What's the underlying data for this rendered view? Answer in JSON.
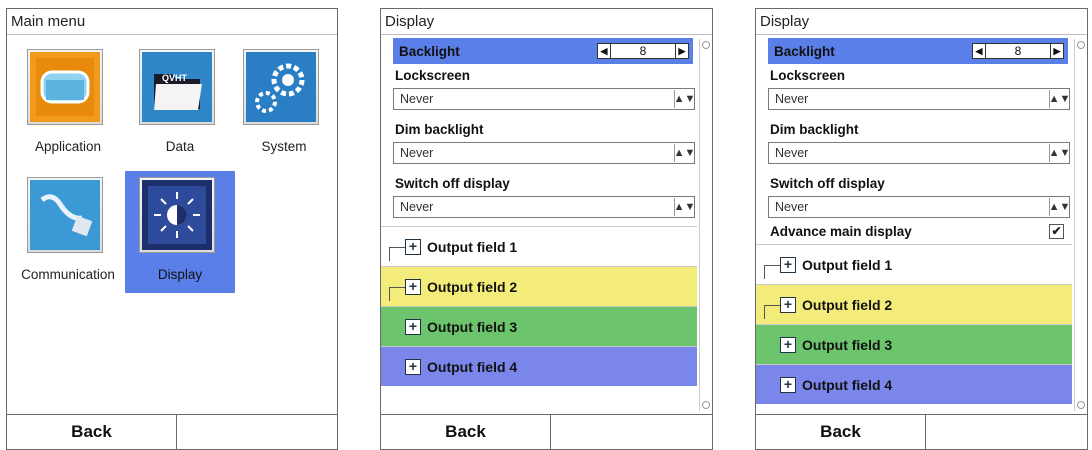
{
  "main_menu": {
    "title": "Main menu",
    "tiles": [
      {
        "label": "Application",
        "icon": "application-icon"
      },
      {
        "label": "Data",
        "icon": "data-folder-icon",
        "badge": "QVHT"
      },
      {
        "label": "System",
        "icon": "system-gears-icon"
      },
      {
        "label": "Communication",
        "icon": "communication-cable-icon"
      },
      {
        "label": "Display",
        "icon": "display-brightness-icon",
        "selected": true
      }
    ],
    "back_label": "Back"
  },
  "display_a": {
    "title": "Display",
    "backlight_label": "Backlight",
    "backlight_value": "8",
    "lockscreen_label": "Lockscreen",
    "lockscreen_value": "Never",
    "dim_label": "Dim backlight",
    "dim_value": "Never",
    "switchoff_label": "Switch off display",
    "switchoff_value": "Never",
    "output_fields": [
      "Output field 1",
      "Output field 2",
      "Output field 3",
      "Output field 4"
    ],
    "back_label": "Back"
  },
  "display_b": {
    "title": "Display",
    "backlight_label": "Backlight",
    "backlight_value": "8",
    "lockscreen_label": "Lockscreen",
    "lockscreen_value": "Never",
    "dim_label": "Dim backlight",
    "dim_value": "Never",
    "switchoff_label": "Switch off display",
    "switchoff_value": "Never",
    "advance_label": "Advance main display",
    "advance_checked": true,
    "output_fields": [
      "Output field 1",
      "Output field 2",
      "Output field 3",
      "Output field 4"
    ],
    "back_label": "Back"
  },
  "colors": {
    "selection": "#5b7fe8",
    "output_field_2": "#f4ec7a",
    "output_field_3": "#6cc46c",
    "output_field_4": "#7b86ea"
  }
}
